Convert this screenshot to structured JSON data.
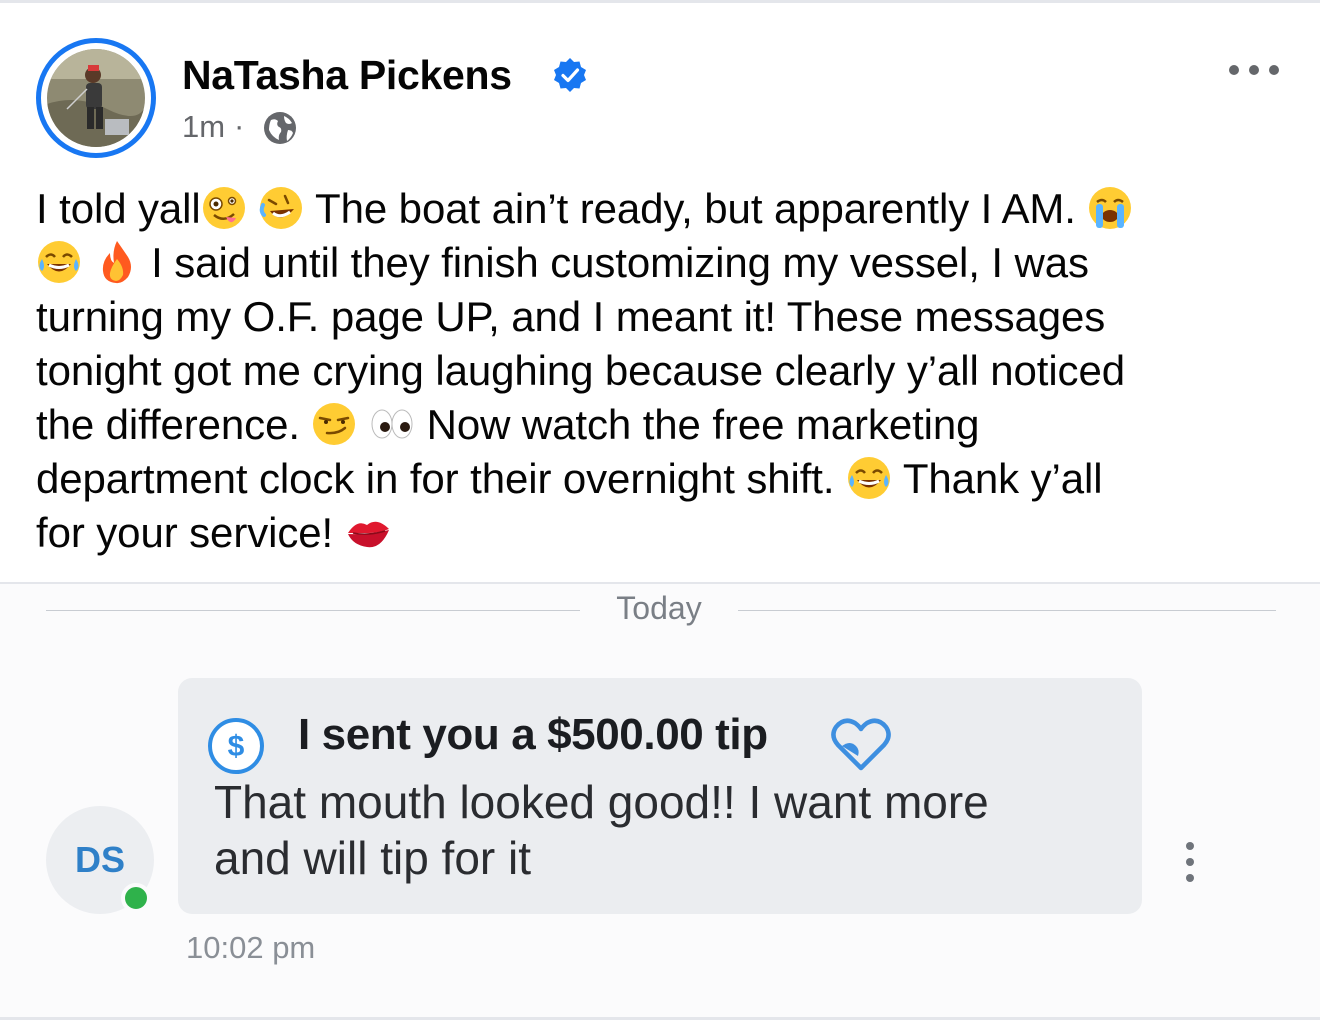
{
  "post": {
    "author_name": "NaTasha Pickens",
    "verified": true,
    "timestamp": "1m",
    "separator": "·",
    "audience_icon": "globe-icon",
    "menu_icon": "more-horizontal-icon",
    "text_lines": [
      [
        "I told yall",
        "",
        " ",
        "",
        " The boat ain’t ready, but apparently I AM. ",
        ""
      ],
      [
        "",
        " ",
        "",
        " I said until they finish customizing my vessel, I was"
      ],
      [
        "turning my O.F. page UP, and I meant it! These messages"
      ],
      [
        "tonight got me crying laughing because clearly y’all noticed"
      ],
      [
        "the difference. ",
        "",
        " ",
        "",
        " Now watch the free marketing"
      ],
      [
        "department clock in for their overnight shift. ",
        "",
        " Thank y’all"
      ],
      [
        "for your service! ",
        ""
      ]
    ],
    "emojis": [
      "zany-face-emoji",
      "rofl-emoji",
      "loudly-crying-emoji",
      "tears-of-joy-emoji",
      "fire-emoji",
      "smirk-emoji",
      "eyes-emoji",
      "tears-of-joy-emoji",
      "kiss-mark-emoji"
    ]
  },
  "screenshot": {
    "day_label": "Today",
    "sender_initials": "DS",
    "sender_online": true,
    "tip_title": "I sent you a $500.00 tip",
    "tip_icon": "dollar-circle-icon",
    "heart_icon": "heart-icon",
    "message_lines": [
      "That mouth looked good!! I want more",
      "and will tip for it"
    ],
    "message_time": "10:02 pm",
    "menu_icon": "more-vertical-icon"
  },
  "colors": {
    "accent_blue": "#1877f2",
    "secondary_text": "#65676b",
    "bubble_bg": "#ebedf0",
    "online_green": "#2fb24b",
    "initials_blue": "#2f80c8"
  }
}
